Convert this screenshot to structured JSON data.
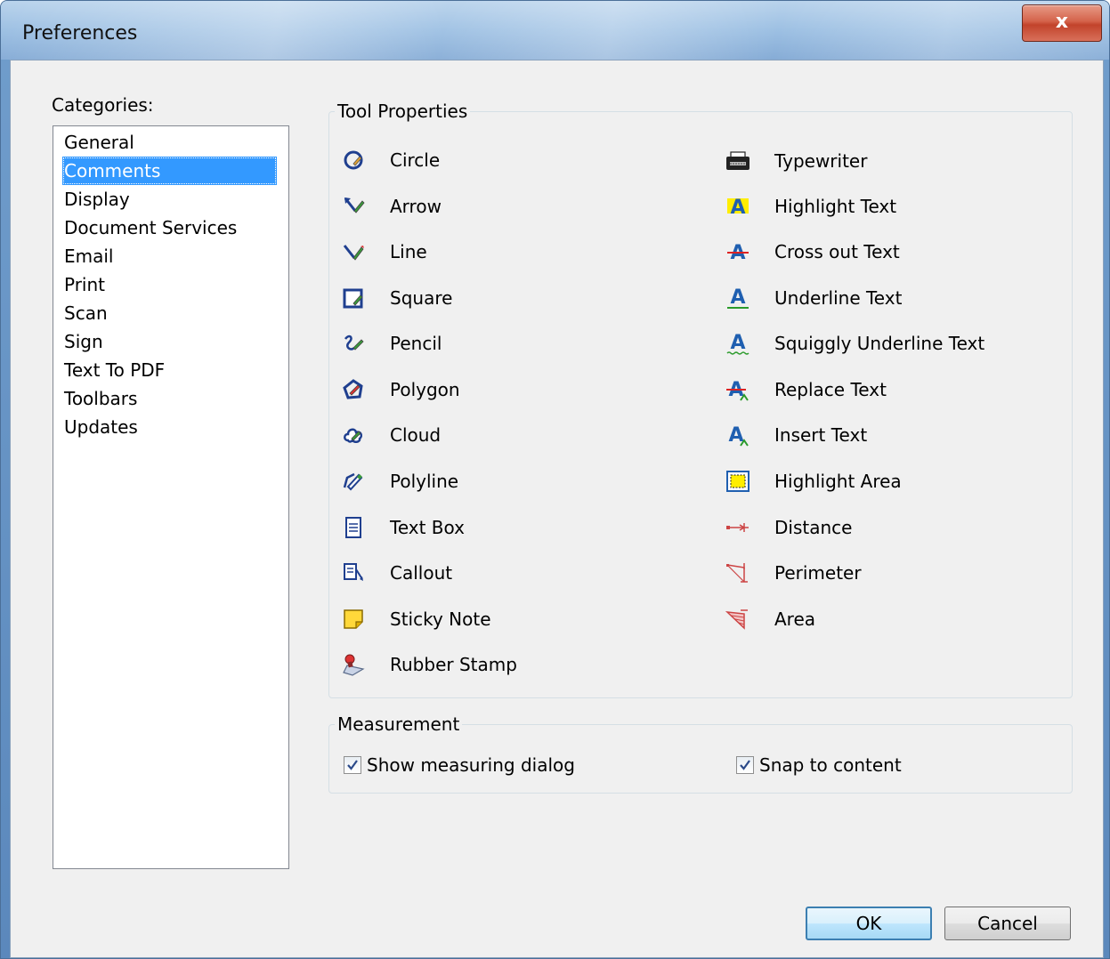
{
  "window": {
    "title": "Preferences",
    "close_label": "x"
  },
  "categories": {
    "label": "Categories:",
    "items": [
      {
        "label": "General",
        "selected": false
      },
      {
        "label": "Comments",
        "selected": true
      },
      {
        "label": "Display",
        "selected": false
      },
      {
        "label": "Document Services",
        "selected": false
      },
      {
        "label": "Email",
        "selected": false
      },
      {
        "label": "Print",
        "selected": false
      },
      {
        "label": "Scan",
        "selected": false
      },
      {
        "label": "Sign",
        "selected": false
      },
      {
        "label": "Text To PDF",
        "selected": false
      },
      {
        "label": "Toolbars",
        "selected": false
      },
      {
        "label": "Updates",
        "selected": false
      }
    ]
  },
  "tool_properties": {
    "title": "Tool Properties",
    "left": [
      {
        "label": "Circle",
        "icon": "circle-icon"
      },
      {
        "label": "Arrow",
        "icon": "arrow-icon"
      },
      {
        "label": "Line",
        "icon": "line-icon"
      },
      {
        "label": "Square",
        "icon": "square-icon"
      },
      {
        "label": "Pencil",
        "icon": "pencil-icon"
      },
      {
        "label": "Polygon",
        "icon": "polygon-icon"
      },
      {
        "label": "Cloud",
        "icon": "cloud-icon"
      },
      {
        "label": "Polyline",
        "icon": "polyline-icon"
      },
      {
        "label": "Text Box",
        "icon": "text-box-icon"
      },
      {
        "label": "Callout",
        "icon": "callout-icon"
      },
      {
        "label": "Sticky Note",
        "icon": "sticky-note-icon"
      },
      {
        "label": "Rubber Stamp",
        "icon": "rubber-stamp-icon"
      }
    ],
    "right": [
      {
        "label": "Typewriter",
        "icon": "typewriter-icon"
      },
      {
        "label": "Highlight Text",
        "icon": "highlight-text-icon"
      },
      {
        "label": "Cross out Text",
        "icon": "cross-out-text-icon"
      },
      {
        "label": "Underline Text",
        "icon": "underline-text-icon"
      },
      {
        "label": "Squiggly Underline Text",
        "icon": "squiggly-underline-text-icon"
      },
      {
        "label": "Replace Text",
        "icon": "replace-text-icon"
      },
      {
        "label": "Insert Text",
        "icon": "insert-text-icon"
      },
      {
        "label": "Highlight Area",
        "icon": "highlight-area-icon"
      },
      {
        "label": "Distance",
        "icon": "distance-icon"
      },
      {
        "label": "Perimeter",
        "icon": "perimeter-icon"
      },
      {
        "label": "Area",
        "icon": "area-icon"
      }
    ]
  },
  "measurement": {
    "title": "Measurement",
    "show_measuring_dialog": {
      "label": "Show measuring dialog",
      "checked": true
    },
    "snap_to_content": {
      "label": "Snap to content",
      "checked": true
    }
  },
  "buttons": {
    "ok": "OK",
    "cancel": "Cancel"
  }
}
